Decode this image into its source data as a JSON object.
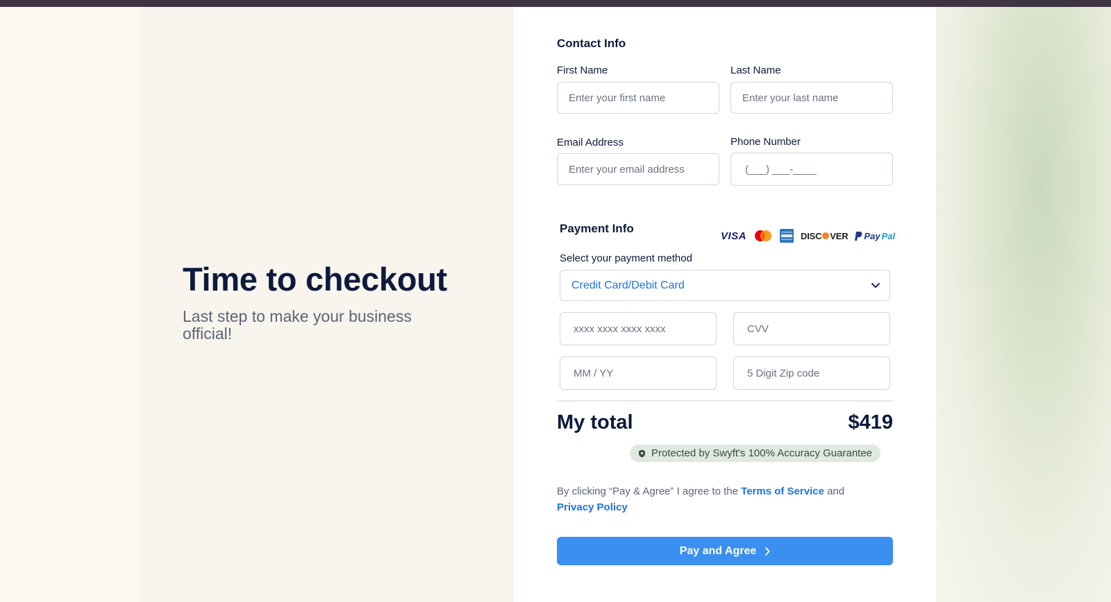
{
  "hero": {
    "title": "Time to checkout",
    "subtitle": "Last step to make your business official!"
  },
  "contact": {
    "section_title": "Contact Info",
    "first_name": {
      "label": "First Name",
      "placeholder": "Enter your first name"
    },
    "last_name": {
      "label": "Last Name",
      "placeholder": "Enter your last name"
    },
    "email": {
      "label": "Email Address",
      "placeholder": "Enter your email address"
    },
    "phone": {
      "label": "Phone Number",
      "placeholder": "(___) ___-____"
    }
  },
  "payment": {
    "section_title": "Payment Info",
    "logos": {
      "visa": "VISA",
      "discover_pre": "DISC",
      "discover_post": "VER",
      "paypal_pay": "Pay",
      "paypal_pal": "Pal"
    },
    "method_label": "Select your payment method",
    "method_value": "Credit Card/Debit Card",
    "card_number": {
      "placeholder": "xxxx xxxx xxxx xxxx"
    },
    "cvv": {
      "placeholder": "CVV"
    },
    "expiry": {
      "placeholder": "MM / YY"
    },
    "zip": {
      "placeholder": "5 Digit Zip code"
    }
  },
  "total": {
    "label": "My total",
    "amount": "$419",
    "guarantee": "Protected by Swyft's 100% Accuracy Guarantee"
  },
  "legal": {
    "prefix": "By clicking “Pay & Agree” I agree to the ",
    "terms_link": "Terms of Service",
    "middle": " and ",
    "privacy_link": "Privacy Policy"
  },
  "cta": {
    "label": "Pay and Agree"
  },
  "colors": {
    "accent": "#3b8ff0",
    "link": "#1a73e8",
    "heading": "#0c1a3c",
    "badge_bg": "#dfe9df"
  }
}
